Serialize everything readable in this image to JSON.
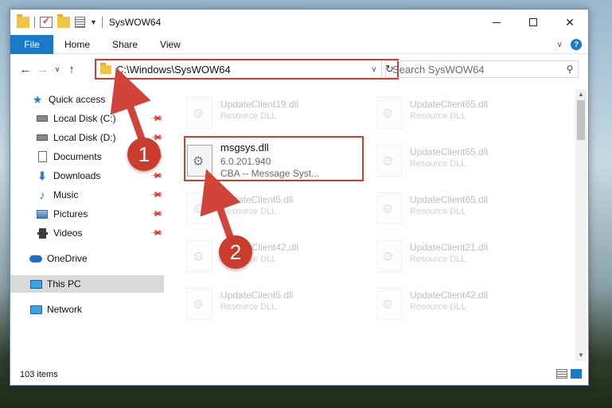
{
  "window": {
    "title": "SysWOW64",
    "minimize_glyph": "—",
    "maximize_glyph": "☐",
    "close_glyph": "✕"
  },
  "ribbon": {
    "file": "File",
    "home": "Home",
    "share": "Share",
    "view": "View"
  },
  "nav": {
    "address": "C:\\Windows\\SysWOW64",
    "search_placeholder": "Search SysWOW64"
  },
  "sidebar": {
    "items": [
      {
        "label": "Quick access",
        "icon": "star-icon"
      },
      {
        "label": "Local Disk (C:)",
        "icon": "disk-icon"
      },
      {
        "label": "Local Disk (D:)",
        "icon": "disk-icon"
      },
      {
        "label": "Documents",
        "icon": "documents-icon"
      },
      {
        "label": "Downloads",
        "icon": "download-icon"
      },
      {
        "label": "Music",
        "icon": "music-icon"
      },
      {
        "label": "Pictures",
        "icon": "pictures-icon"
      },
      {
        "label": "Videos",
        "icon": "videos-icon"
      },
      {
        "label": "OneDrive",
        "icon": "cloud-icon"
      },
      {
        "label": "This PC",
        "icon": "computer-icon"
      },
      {
        "label": "Network",
        "icon": "network-icon"
      }
    ]
  },
  "files": [
    {
      "name": "UpdateClient19.dll",
      "sub": "Resource DLL"
    },
    {
      "name": "UpdateClient65.dll",
      "sub": "Resource DLL"
    },
    {
      "name": "msgsys.dll",
      "version": "6.0.201.940",
      "desc": "CBA -- Message Syst..."
    },
    {
      "name": "UpdateClient65.dll",
      "sub": "Resource DLL"
    },
    {
      "name": "UpdateClient5.dll",
      "sub": "Resource DLL"
    },
    {
      "name": "UpdateClient65.dll",
      "sub": "Resource DLL"
    },
    {
      "name": "UpdateClient42.dll",
      "sub": "Resource DLL"
    },
    {
      "name": "UpdateClient21.dll",
      "sub": "Resource DLL"
    },
    {
      "name": "UpdateClient5.dll",
      "sub": "Resource DLL"
    },
    {
      "name": "UpdateClient42.dll",
      "sub": "Resource DLL"
    }
  ],
  "status": {
    "items_count": "103 items"
  },
  "callouts": {
    "one": "1",
    "two": "2"
  },
  "colors": {
    "accent": "#1979ca",
    "highlight_border": "#d43a33",
    "callout": "#c93c2e"
  }
}
